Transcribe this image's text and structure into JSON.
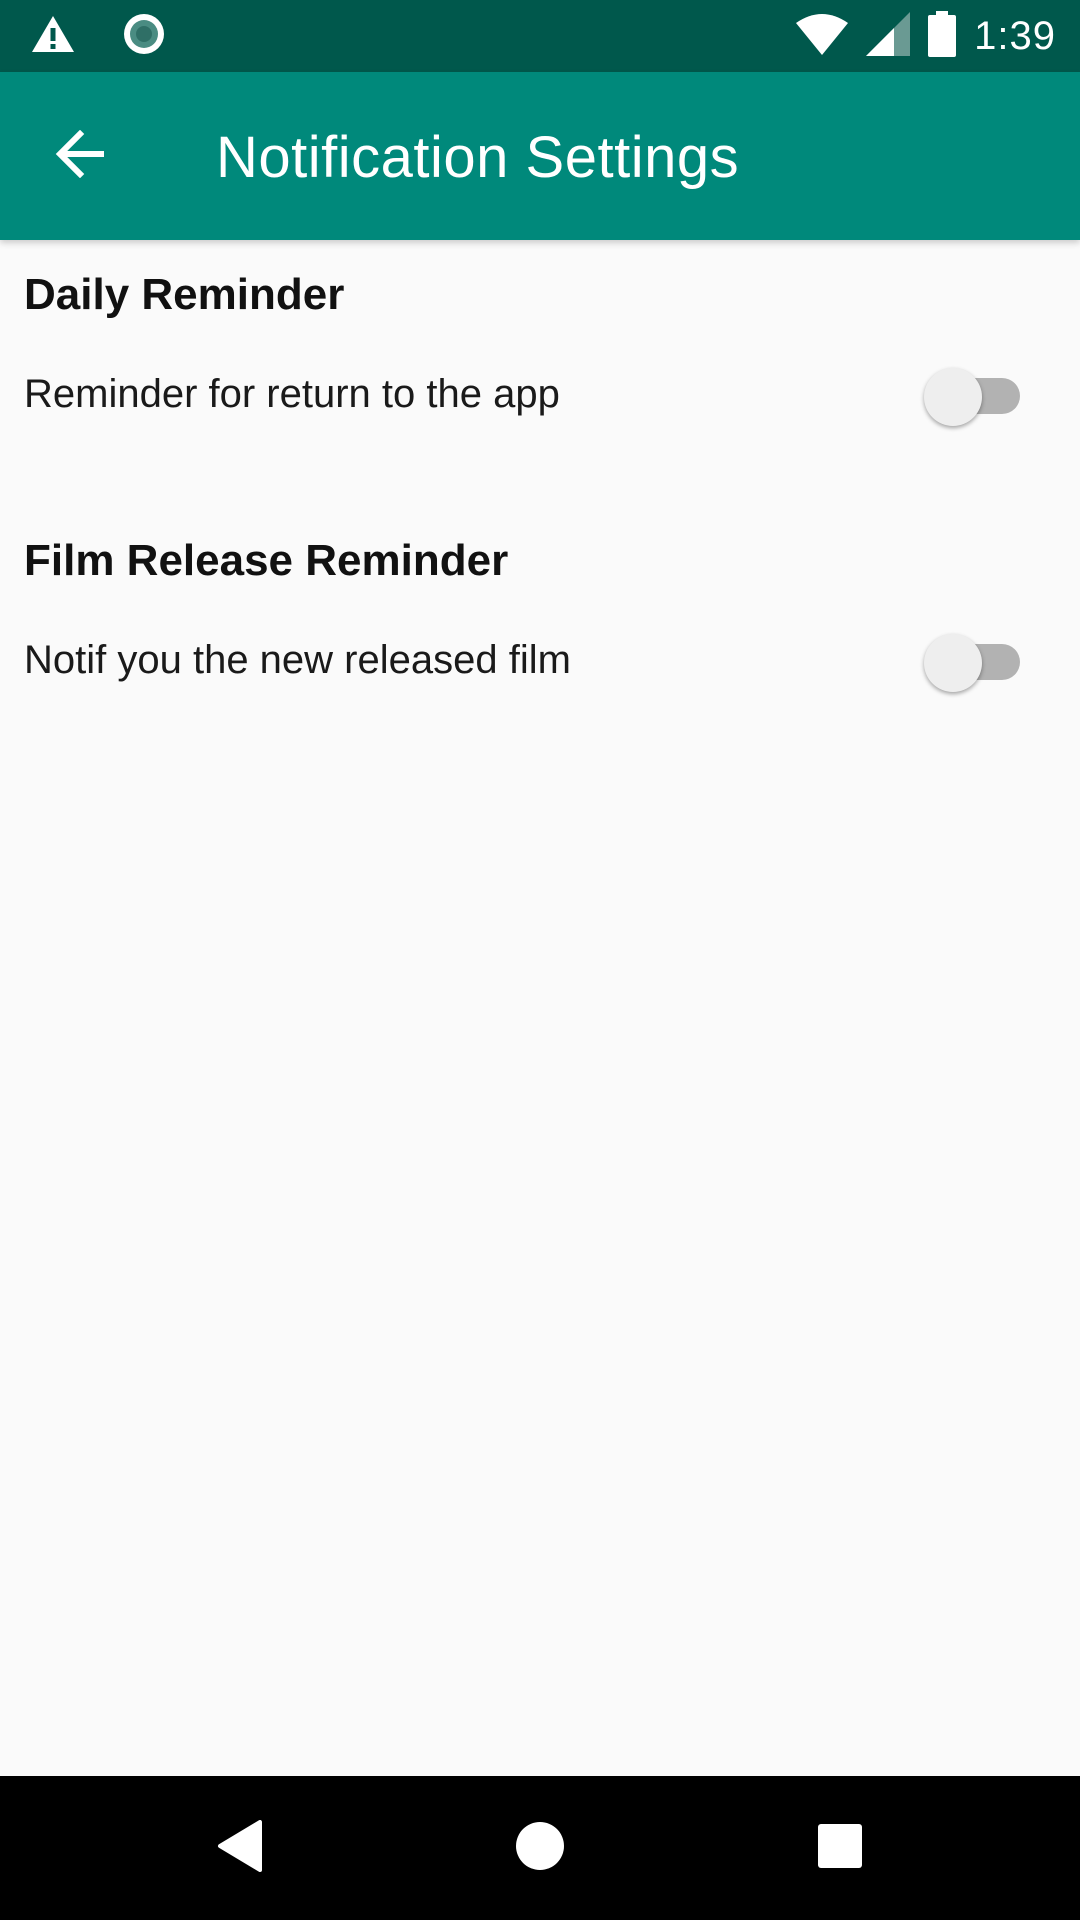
{
  "status_bar": {
    "time": "1:39",
    "icons": [
      "warning-icon",
      "record-icon",
      "wifi-icon",
      "signal-icon",
      "battery-icon"
    ]
  },
  "app_bar": {
    "title": "Notification Settings",
    "back_icon": "arrow-back-icon",
    "background": "#00897b"
  },
  "sections": [
    {
      "title": "Daily Reminder",
      "label": "Reminder for return to the app",
      "enabled": false
    },
    {
      "title": "Film Release Reminder",
      "label": "Notif you the new released film",
      "enabled": false
    }
  ],
  "nav_bar": {
    "icons": [
      "back-triangle-icon",
      "home-circle-icon",
      "recents-square-icon"
    ]
  },
  "colors": {
    "status_bar": "#00584c",
    "app_bar": "#00897b",
    "background": "#fafafa",
    "switch_track_off": "#b2b2b2",
    "switch_thumb_off": "#eeeeee"
  }
}
